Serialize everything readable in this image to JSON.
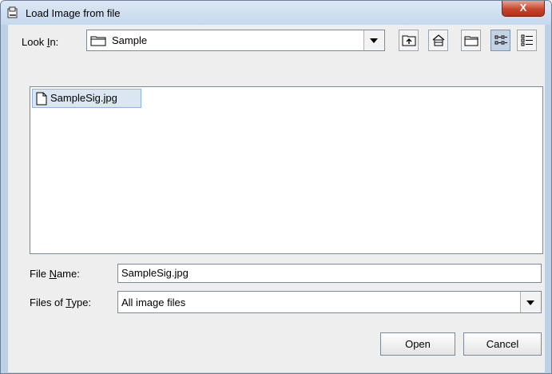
{
  "window": {
    "title": "Load Image from file",
    "close_label": "X"
  },
  "look_in": {
    "label_pre": "Look ",
    "label_mnemonic": "I",
    "label_post": "n:",
    "value": "Sample"
  },
  "toolbar": {
    "buttons": [
      {
        "name": "up-one-level",
        "icon": "folder-up-icon"
      },
      {
        "name": "home",
        "icon": "home-icon"
      },
      {
        "name": "new-folder",
        "icon": "new-folder-icon"
      },
      {
        "name": "list-view",
        "icon": "list-view-icon",
        "active": true
      },
      {
        "name": "details-view",
        "icon": "details-view-icon"
      }
    ]
  },
  "files": [
    {
      "name": "SampleSig.jpg",
      "selected": true
    }
  ],
  "file_name": {
    "label_pre": "File ",
    "label_mnemonic": "N",
    "label_post": "ame:",
    "value": "SampleSig.jpg"
  },
  "file_type": {
    "label_pre": "Files of ",
    "label_mnemonic": "T",
    "label_post": "ype:",
    "value": "All image files"
  },
  "buttons": {
    "open": "Open",
    "cancel": "Cancel"
  },
  "colors": {
    "frame": "#bcd0e6",
    "panel": "#eeeeee",
    "selection": "#dbe6f3",
    "close_button": "#c7452c"
  }
}
